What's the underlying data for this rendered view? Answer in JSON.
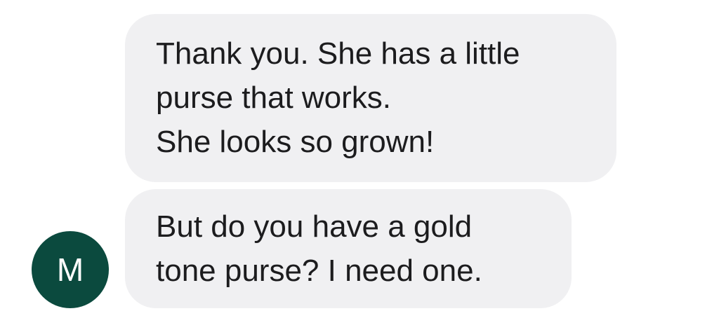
{
  "messages": [
    {
      "lines": [
        "Thank you. She has a little",
        "purse that works.",
        "She looks so grown!"
      ]
    },
    {
      "lines": [
        "But do you have a gold",
        "tone purse? I need one."
      ]
    }
  ],
  "sender": {
    "initial": "M",
    "avatar_color": "#0b4a3e"
  },
  "colors": {
    "bubble_background": "#f0f0f2",
    "text": "#1c1c1e",
    "page_background": "#ffffff"
  }
}
